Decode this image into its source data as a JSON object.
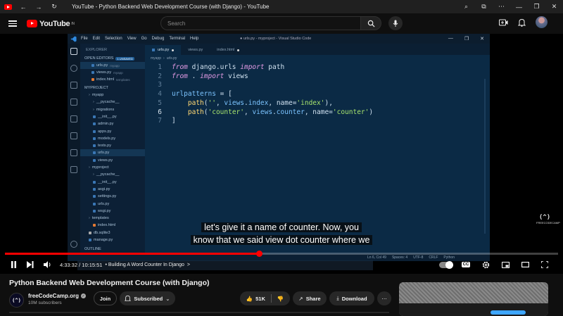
{
  "window": {
    "title": "YouTube - Python Backend Web Development Course (with Django) - YouTube"
  },
  "masthead": {
    "logo_text": "YouTube",
    "logo_superscript": "IN",
    "search_placeholder": "Search"
  },
  "vscode": {
    "menu": [
      "File",
      "Edit",
      "Selection",
      "View",
      "Go",
      "Debug",
      "Terminal",
      "Help"
    ],
    "title": "● urls.py - myproject - Visual Studio Code",
    "tabs": [
      {
        "label": "urls.py",
        "active": true
      },
      {
        "label": "views.py",
        "active": false
      },
      {
        "label": "index.html",
        "active": false
      }
    ],
    "breadcrumbs": [
      "myapp",
      "urls.py"
    ],
    "sidebar": {
      "explorer_label": "EXPLORER",
      "open_editors_label": "OPEN EDITORS",
      "unsaved_badge": "1 UNSAVED",
      "open_editors": [
        {
          "name": "urls.py",
          "folder": "myapp"
        },
        {
          "name": "views.py",
          "folder": "myapp"
        },
        {
          "name": "index.html",
          "folder": "templates"
        }
      ],
      "project_label": "MYPROJECT",
      "tree": [
        "myapp",
        "__pycache__",
        "migrations",
        "__init__.py",
        "admin.py",
        "apps.py",
        "models.py",
        "tests.py",
        "urls.py",
        "views.py",
        "myproject",
        "__pycache__",
        "__init__.py",
        "asgi.py",
        "settings.py",
        "urls.py",
        "wsgi.py",
        "templates",
        "index.html",
        "db.sqlite3",
        "manage.py"
      ],
      "outline_label": "OUTLINE"
    },
    "code_lines": [
      {
        "n": "1",
        "text": "from django.urls import path"
      },
      {
        "n": "2",
        "text": "from . import views"
      },
      {
        "n": "3",
        "text": ""
      },
      {
        "n": "4",
        "text": "urlpatterns = ["
      },
      {
        "n": "5",
        "text": "    path('', views.index, name='index'),"
      },
      {
        "n": "6",
        "text": "    path('counter', views.counter, name='counter')"
      },
      {
        "n": "7",
        "text": "]"
      }
    ],
    "status_items": [
      "Ln 6, Col 49",
      "Spaces: 4",
      "UTF-8",
      "CRLF",
      "Python"
    ]
  },
  "video": {
    "subtitle_lines": [
      "let's give it a name of counter. Now, you",
      "know that we said view dot counter where we"
    ],
    "watermark_label": "FREECODECAMP",
    "watermark_logo": "(^)",
    "progress": 0.459,
    "timecode": "4:33:32 / 10:15:51",
    "chapter": "• Building A Word Counter In Django",
    "chapter_chevron": ">"
  },
  "meta": {
    "title": "Python Backend Web Development Course (with Django)",
    "channel_name": "freeCodeCamp.org",
    "channel_logo": "(^)",
    "subscribers": "10M subscribers",
    "join_label": "Join",
    "subscribed_label": "Subscribed",
    "likes": "51K",
    "share_label": "Share",
    "download_label": "Download"
  }
}
